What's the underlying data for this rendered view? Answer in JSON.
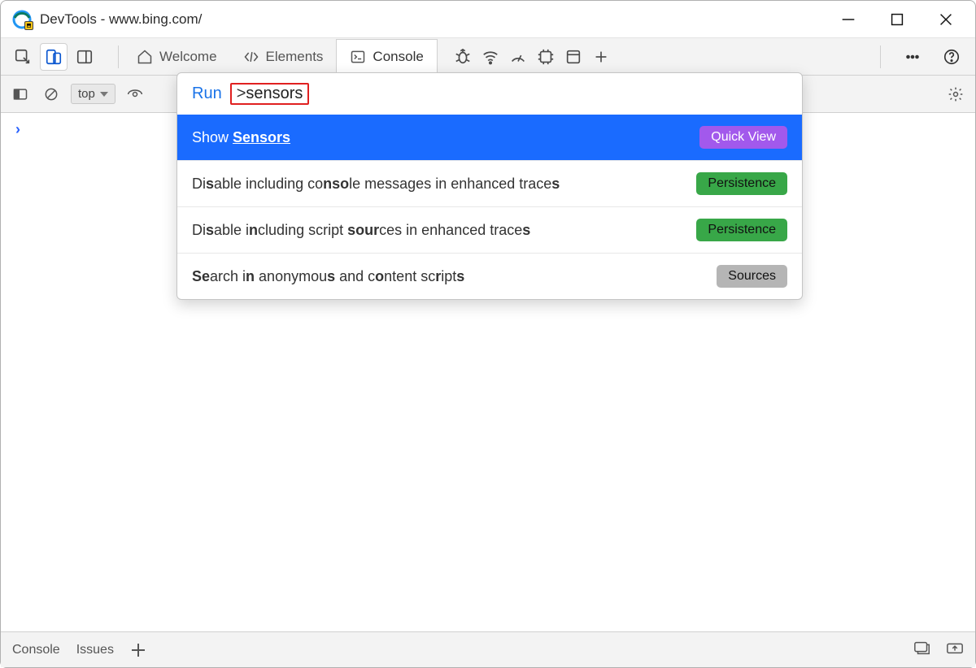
{
  "window": {
    "title": "DevTools - www.bing.com/"
  },
  "tabs": {
    "welcome": "Welcome",
    "elements": "Elements",
    "console": "Console"
  },
  "filter": {
    "context": "top"
  },
  "command_menu": {
    "run_label": "Run",
    "prompt_char": ">",
    "query": "sensors",
    "items": [
      {
        "label_html": "Show <b class='u'>Sensors</b>",
        "pill": "Quick View",
        "pill_style": "purple",
        "selected": true
      },
      {
        "label_html": "Di<b>s</b>able including co<b>nso</b>le messages in enhanced trace<b>s</b>",
        "pill": "Persistence",
        "pill_style": "green",
        "selected": false
      },
      {
        "label_html": "Di<b>s</b>able i<b>n</b>cluding script <b>sour</b>ces in enhanced trace<b>s</b>",
        "pill": "Persistence",
        "pill_style": "green",
        "selected": false
      },
      {
        "label_html": "<b>Se</b>arch i<b>n</b> anonymou<b>s</b> and c<b>o</b>ntent sc<b>r</b>ipt<b>s</b>",
        "pill": "Sources",
        "pill_style": "gray",
        "selected": false
      }
    ]
  },
  "status": {
    "drawer_console": "Console",
    "issues": "Issues"
  }
}
